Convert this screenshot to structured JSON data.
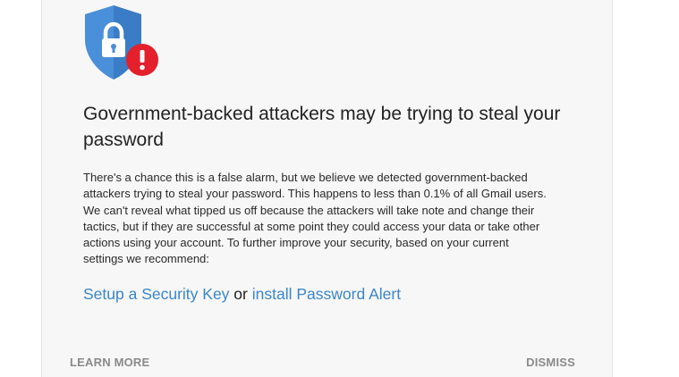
{
  "dialog": {
    "headline": "Government-backed attackers may be trying to steal your password",
    "body": "There's a chance this is a false alarm, but we believe we detected government-backed attackers trying to steal your password. This happens to less than 0.1% of all Gmail users. We can't reveal what tipped us off because the attackers will take note and change their tactics, but if they are successful at some point they could access your data or take other actions using your account. To further improve your security, based on your current settings we recommend:",
    "recommendation": {
      "link1": "Setup a Security Key",
      "conjunction": "or",
      "link2": "install Password Alert"
    },
    "footer": {
      "learn_more": "LEARN MORE",
      "dismiss": "DISMISS"
    },
    "icons": {
      "shield": "shield-lock-icon",
      "alert": "alert-badge-icon"
    },
    "colors": {
      "shield_blue": "#4a8fd9",
      "shield_dark": "#3a7cc5",
      "alert_red": "#e3202b",
      "link_blue": "#3b86c9",
      "footer_grey": "#8a8a8a"
    }
  }
}
